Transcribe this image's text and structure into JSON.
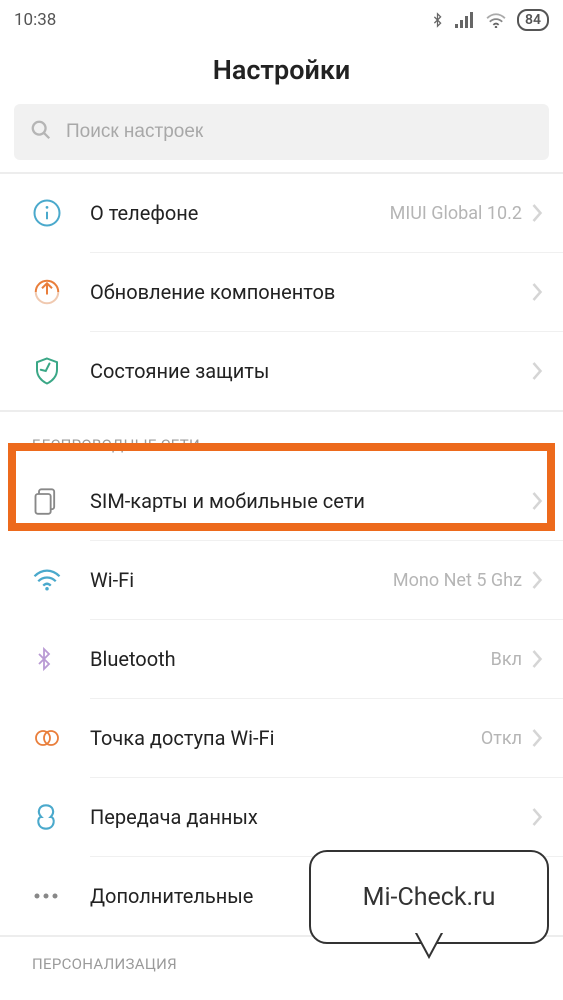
{
  "status": {
    "time": "10:38",
    "battery": "84"
  },
  "title": "Настройки",
  "search": {
    "placeholder": "Поиск настроек"
  },
  "groups": {
    "system": [
      {
        "label": "О телефоне",
        "value": "MIUI Global 10.2"
      },
      {
        "label": "Обновление компонентов",
        "value": ""
      },
      {
        "label": "Состояние защиты",
        "value": ""
      }
    ],
    "wireless_header": "БЕСПРОВОДНЫЕ СЕТИ",
    "wireless": [
      {
        "label": "SIM-карты и мобильные сети",
        "value": ""
      },
      {
        "label": "Wi-Fi",
        "value": "Mono Net 5 Ghz"
      },
      {
        "label": "Bluetooth",
        "value": "Вкл"
      },
      {
        "label": "Точка доступа Wi-Fi",
        "value": "Откл"
      },
      {
        "label": "Передача данных",
        "value": ""
      },
      {
        "label": "Дополнительные",
        "value": ""
      }
    ],
    "personalization_header": "ПЕРСОНАЛИЗАЦИЯ"
  },
  "bubble": "Mi-Check.ru"
}
